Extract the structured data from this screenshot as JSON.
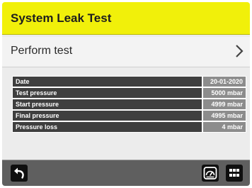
{
  "header": {
    "title": "System Leak Test"
  },
  "perform": {
    "label": "Perform test",
    "icon": "chevron-right-icon"
  },
  "results": [
    {
      "label": "Date",
      "value": "20-01-2020"
    },
    {
      "label": "Test pressure",
      "value": "5000 mbar"
    },
    {
      "label": "Start pressure",
      "value": "4999 mbar"
    },
    {
      "label": "Final pressure",
      "value": "4995 mbar"
    },
    {
      "label": "Pressure loss",
      "value": "4 mbar"
    }
  ],
  "footer": {
    "back_icon": "back-arrow-icon",
    "gauge_icon": "gauge-icon",
    "menu_icon": "grid-menu-icon"
  },
  "colors": {
    "header": "#f1f00a",
    "label_cell": "#3f3f3f",
    "value_cell": "#8c8c8c",
    "footer": "#5f5f5f"
  }
}
